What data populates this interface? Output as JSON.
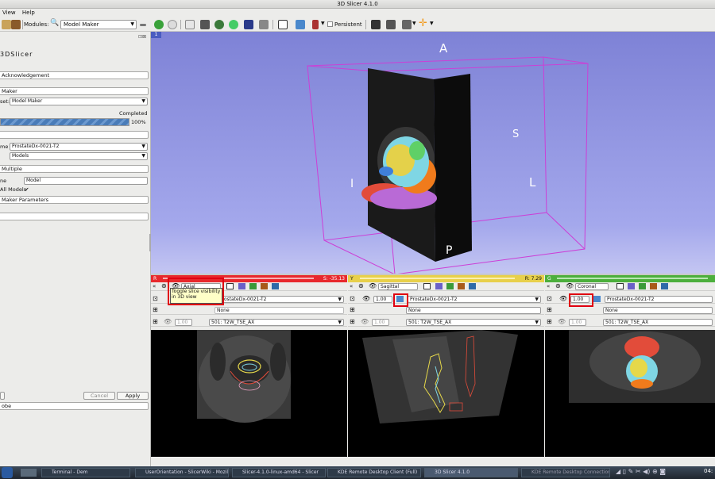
{
  "window": {
    "title": "3D Slicer 4.1.0"
  },
  "menu": [
    "View",
    "Help"
  ],
  "toolbar": {
    "modules_label": "Modules:",
    "module": "Model Maker",
    "persistent": "Persistent"
  },
  "left_panel": {
    "logo": "3DSlicer",
    "acknowledgement": "Acknowledgement",
    "model_maker_header": "Maker",
    "preset_label": "set:",
    "preset": "Model Maker",
    "status": "Completed",
    "progress_text": "100%",
    "progress_value": 1.0,
    "volume_label": "me",
    "volume": "ProstateDx-0021-T2",
    "models": "Models",
    "multiple": "Multiple",
    "name_label": "ne",
    "name_value": "Model",
    "all_models_label": "All Models",
    "all_models_check": "✔",
    "params_header": "Maker Parameters",
    "cancel": "Cancel",
    "apply": "Apply",
    "probe": "obe"
  },
  "view3d": {
    "index": "1",
    "labels": {
      "A": "A",
      "S": "S",
      "I": "I",
      "L": "L",
      "P": "P"
    }
  },
  "slices": [
    {
      "letter": "R",
      "offset": "S: -35.13",
      "orientation": "Axial",
      "opacity": "1.00",
      "fg": "ProstateDx-0021-T2",
      "label": "None",
      "bg": "501: T2W_TSE_AX",
      "tooltip": "Toggle slice visibility in 3D view",
      "color": "#e8292d"
    },
    {
      "letter": "Y",
      "offset": "R: 7.29",
      "orientation": "Sagittal",
      "opacity": "1.00",
      "fg": "ProstateDx-0021-T2",
      "label": "None",
      "bg": "501: T2W_TSE_AX",
      "color": "#e8d04a"
    },
    {
      "letter": "G",
      "offset": "",
      "orientation": "Coronal",
      "opacity": "1.00",
      "fg": "ProstateDx-0021-T2",
      "label": "None",
      "bg": "501: T2W_TSE_AX",
      "color": "#4caf3c"
    }
  ],
  "taskbar": {
    "tasks": [
      "Terminal - Dem",
      "UserOrientation - SlicerWiki - Mozil",
      "Slicer-4.1.0-linux-amd64 - Slicer",
      "KDE Remote Desktop Client (Full)",
      "3D Slicer 4.1.0",
      "",
      "KDE Remote Desktop Connection"
    ],
    "clock": "04:"
  },
  "colors": {
    "accent_red": "#e00010",
    "progress": "#4a7cb8",
    "view_bg": "#8f93e0",
    "bbox": "#cc3fd6"
  }
}
